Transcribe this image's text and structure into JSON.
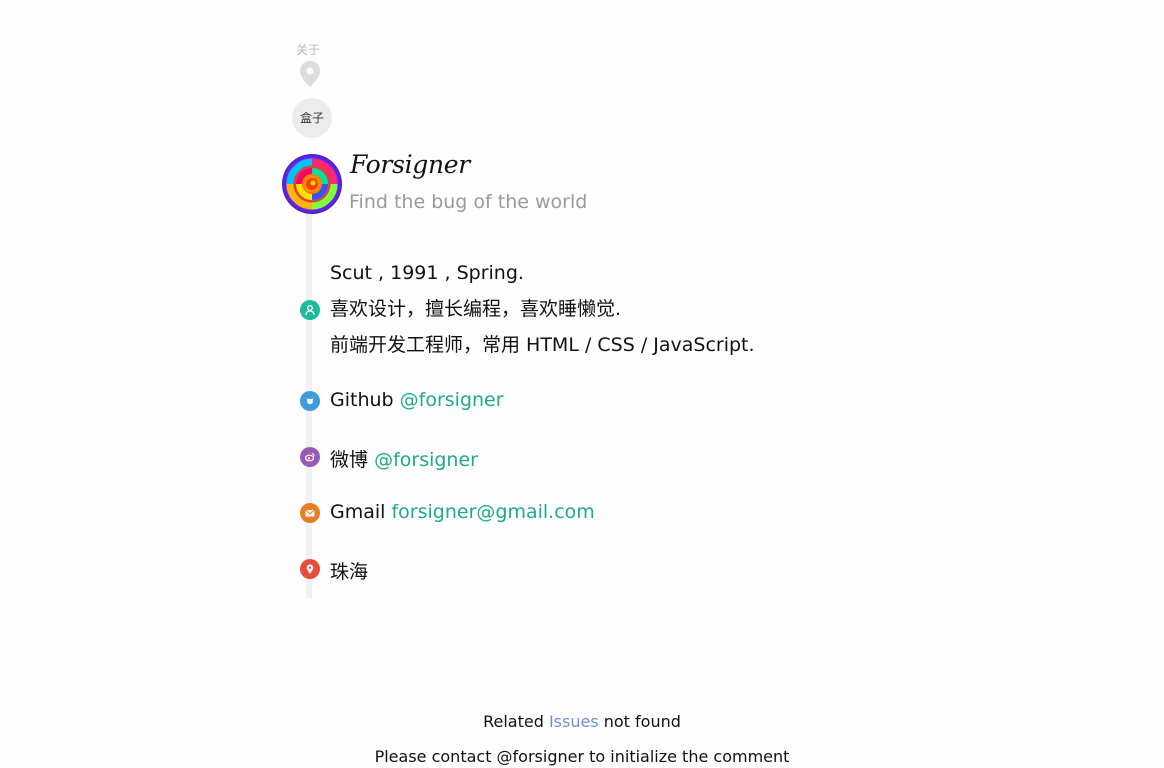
{
  "nav": {
    "label": "关于",
    "box_label": "盒子"
  },
  "profile": {
    "name": "Forsigner",
    "tagline": "Find the bug of the world"
  },
  "bio": [
    "Scut , 1991 , Spring.",
    "喜欢设计，擅长编程，喜欢睡懒觉.",
    "前端开发工程师，常用 HTML / CSS / JavaScript."
  ],
  "contacts": {
    "github": {
      "label": "Github",
      "link": "@forsigner",
      "color": "#3d9cdb",
      "icon": "github-icon"
    },
    "weibo": {
      "label": "微博",
      "link": "@forsigner",
      "color": "#9b59b6",
      "icon": "weibo-icon"
    },
    "gmail": {
      "label": "Gmail",
      "link": "forsigner@gmail.com",
      "color": "#e67e22",
      "icon": "mail-icon"
    },
    "location": {
      "label": "珠海",
      "color": "#e74c3c",
      "icon": "location-pin-icon"
    }
  },
  "bio_icon": {
    "color": "#1abc9c",
    "icon": "user-icon"
  },
  "footer": {
    "related_prefix": "Related",
    "issues_link": "Issues",
    "related_suffix": "not found",
    "contact_text": "Please contact @forsigner to initialize the comment"
  }
}
